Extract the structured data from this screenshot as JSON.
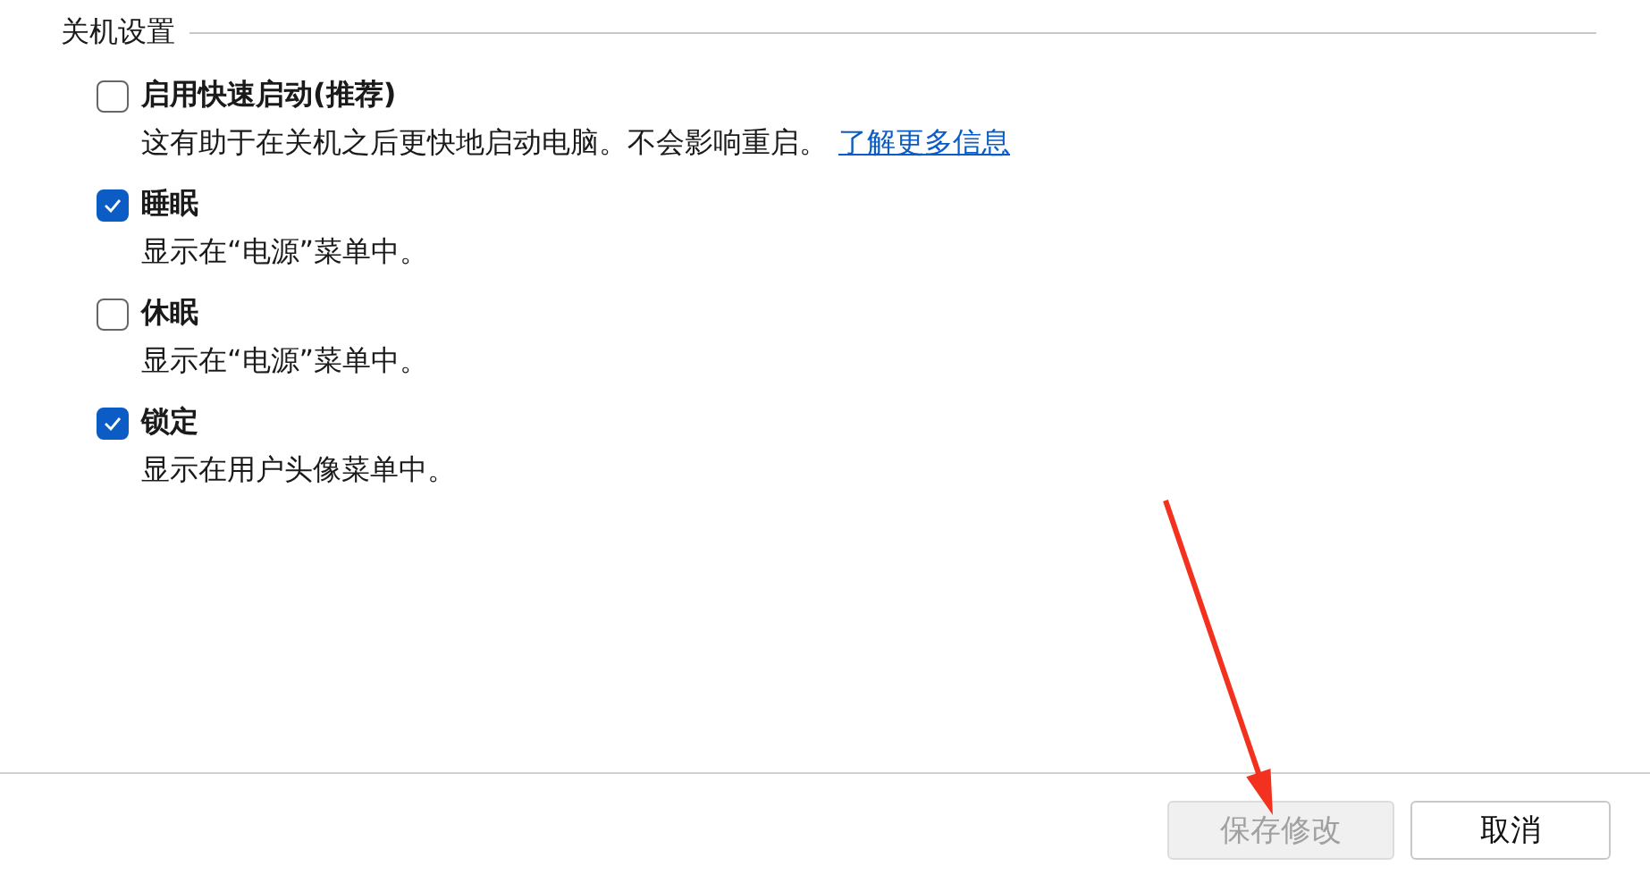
{
  "group": {
    "title": "关机设置"
  },
  "options": [
    {
      "label": "启用快速启动(推荐)",
      "checked": false,
      "description": "这有助于在关机之后更快地启动电脑。不会影响重启。",
      "link": "了解更多信息"
    },
    {
      "label": "睡眠",
      "checked": true,
      "description": "显示在“电源”菜单中。"
    },
    {
      "label": "休眠",
      "checked": false,
      "description": "显示在“电源”菜单中。"
    },
    {
      "label": "锁定",
      "checked": true,
      "description": "显示在用户头像菜单中。"
    }
  ],
  "buttons": [
    {
      "label": "保存修改",
      "disabled": true
    },
    {
      "label": "取消",
      "disabled": false
    }
  ]
}
